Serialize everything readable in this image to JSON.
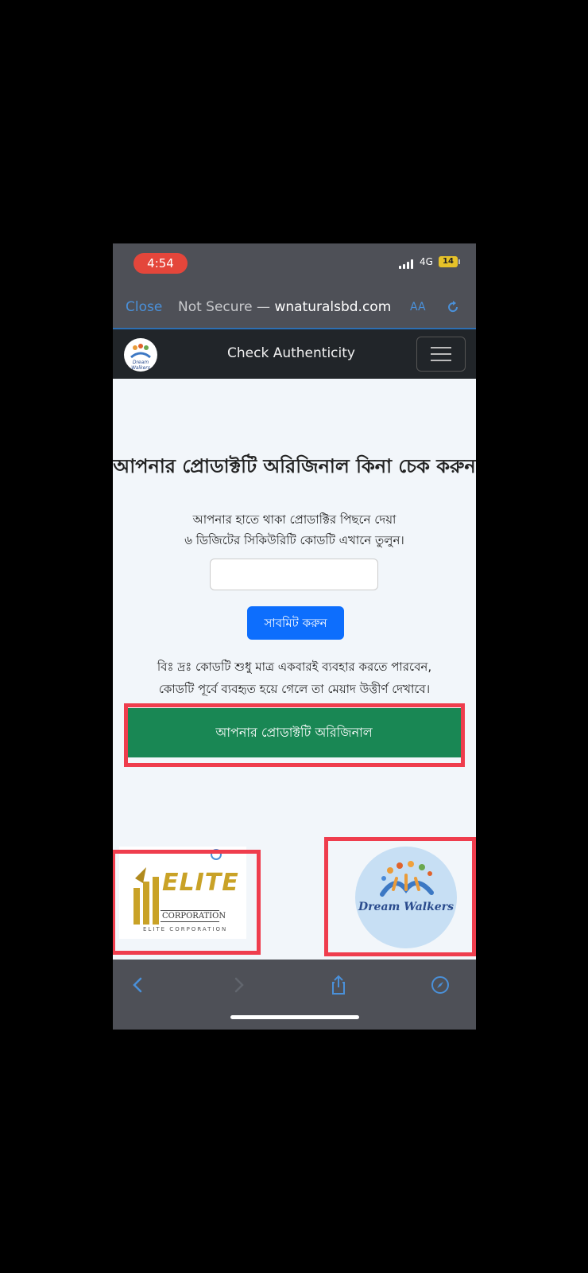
{
  "status_bar": {
    "time": "4:54",
    "network": "4G",
    "battery": "14"
  },
  "address_bar": {
    "close_label": "Close",
    "security_label": "Not Secure —",
    "domain": "wnaturalsbd.com",
    "text_size_label": "AA"
  },
  "navbar": {
    "title": "Check Authenticity",
    "logo_text": "Dream Walkers"
  },
  "main": {
    "heading": "আপনার প্রোডাক্টটি অরিজিনাল কিনা চেক করুন",
    "description_line1": "আপনার হাতে থাকা প্রোডাক্টির পিছনে দেয়া",
    "description_line2": "৬ ডিজিটের সিকিউরিটি কোডটি এখানে তুলুন।",
    "code_value": "",
    "code_placeholder": "",
    "submit_label": "সাবমিট করুন",
    "note_line1": "বিঃ দ্রঃ কোডটি শুধু মাত্র একবারই ব্যবহার করতে পারবেন,",
    "note_line2": "কোডটি পূর্বে ব্যবহৃত হয়ে গেলে তা মেয়াদ উত্তীর্ণ দেখাবে।",
    "result_message": "আপনার প্রোডাক্টটি অরিজিনাল"
  },
  "logos": {
    "elite_word": "ELITE",
    "elite_corp": "CORPORATION",
    "elite_tagline": "ELITE CORPORATION",
    "dream_walkers": "Dream Walkers"
  },
  "colors": {
    "highlight": "#ef3d4d",
    "success": "#198754",
    "primary": "#0d6efd",
    "navbar": "#212529"
  }
}
